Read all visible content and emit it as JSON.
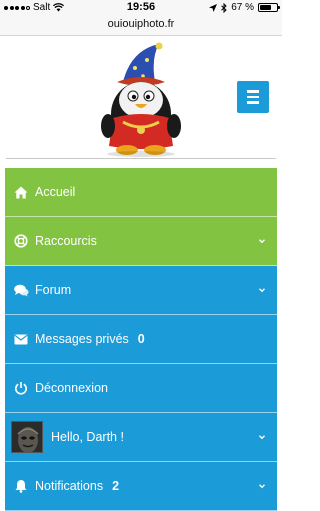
{
  "status_bar": {
    "carrier": "Salt",
    "time": "19:56",
    "battery": "67 %"
  },
  "url_bar": {
    "url": "ouiouiphoto.fr"
  },
  "header": {
    "menu_toggle_icon": "hamburger-icon"
  },
  "colors": {
    "green": "#82c341",
    "blue": "#1b9bd7"
  },
  "nav": {
    "items": [
      {
        "label": "Accueil",
        "icon": "home-icon",
        "color": "green",
        "has_chevron": false
      },
      {
        "label": "Raccourcis",
        "icon": "lifebuoy-icon",
        "color": "green",
        "has_chevron": true
      },
      {
        "label": "Forum",
        "icon": "comments-icon",
        "color": "blue",
        "has_chevron": true
      },
      {
        "label": "Messages privés",
        "icon": "envelope-icon",
        "color": "blue",
        "has_chevron": false,
        "count": "0"
      },
      {
        "label": "Déconnexion",
        "icon": "power-icon",
        "color": "blue",
        "has_chevron": false
      },
      {
        "label": "Hello, Darth !",
        "icon": "avatar",
        "color": "blue",
        "has_chevron": true
      },
      {
        "label": "Notifications",
        "icon": "bell-icon",
        "color": "blue",
        "has_chevron": true,
        "count": "2"
      }
    ]
  }
}
